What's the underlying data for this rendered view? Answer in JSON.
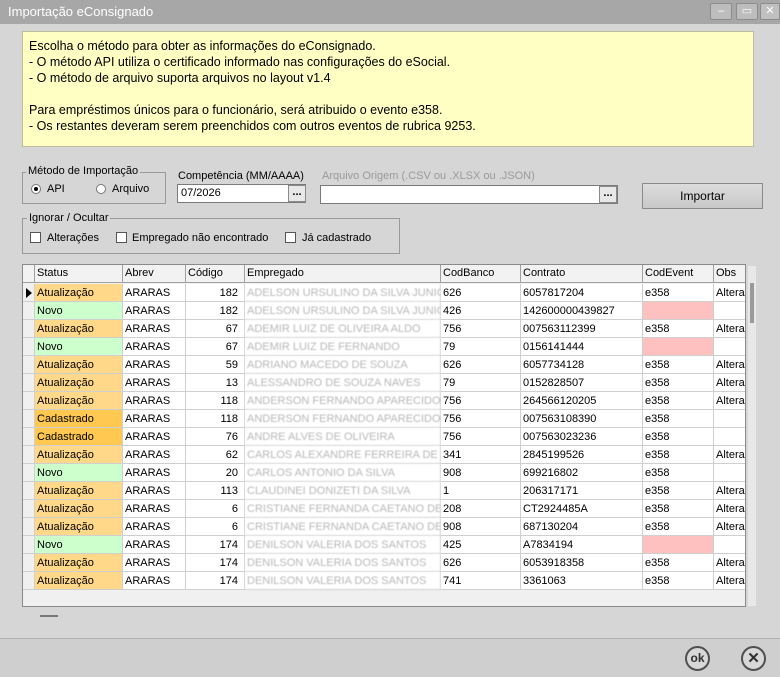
{
  "window": {
    "title": "Importação eConsignado",
    "minimize_symbol": "–",
    "maximize_symbol": "▭",
    "close_symbol": "✕"
  },
  "info_lines": [
    "Escolha o método para obter as informações do eConsignado.",
    "- O método API utiliza o certificado informado nas configurações do eSocial.",
    "- O método de arquivo suporta arquivos no layout v1.4",
    "",
    "Para empréstimos únicos para o funcionário, será atribuido o evento e358.",
    "- Os restantes deveram serem preenchidos com outros eventos de rubrica 9253."
  ],
  "method": {
    "label": "Método de Importação",
    "options": [
      {
        "label": "API",
        "selected": true
      },
      {
        "label": "Arquivo",
        "selected": false
      }
    ]
  },
  "competencia": {
    "label": "Competência (MM/AAAA)",
    "value": "07/2026",
    "button": "..."
  },
  "arquivo": {
    "label": "Arquivo Origem (.CSV ou .XLSX ou .JSON)",
    "value": "",
    "button": "..."
  },
  "import_button": "Importar",
  "ignore": {
    "label": "Ignorar / Ocultar",
    "options": [
      {
        "label": "Alterações",
        "checked": false
      },
      {
        "label": "Empregado não encontrado",
        "checked": false
      },
      {
        "label": "Já cadastrado",
        "checked": false
      }
    ]
  },
  "grid": {
    "columns": [
      "Status",
      "Abrev",
      "Código",
      "Empregado",
      "CodBanco",
      "Contrato",
      "CodEvent",
      "Obs"
    ],
    "rows": [
      {
        "status": "Atualização",
        "abrev": "ARARAS",
        "codigo": "182",
        "empregado": "ADELSON URSULINO DA SILVA JUNIOR",
        "codbanco": "626",
        "contrato": "6057817204",
        "codevent": "e358",
        "obs": "Altera"
      },
      {
        "status": "Novo",
        "abrev": "ARARAS",
        "codigo": "182",
        "empregado": "ADELSON URSULINO DA SILVA JUNIOR",
        "codbanco": "426",
        "contrato": "142600000439827",
        "codevent": "",
        "obs": ""
      },
      {
        "status": "Atualização",
        "abrev": "ARARAS",
        "codigo": "67",
        "empregado": "ADEMIR LUIZ DE OLIVEIRA ALDO",
        "codbanco": "756",
        "contrato": "007563112399",
        "codevent": "e358",
        "obs": "Altera"
      },
      {
        "status": "Novo",
        "abrev": "ARARAS",
        "codigo": "67",
        "empregado": "ADEMIR LUIZ DE FERNANDO",
        "codbanco": "79",
        "contrato": "0156141444",
        "codevent": "",
        "obs": ""
      },
      {
        "status": "Atualização",
        "abrev": "ARARAS",
        "codigo": "59",
        "empregado": "ADRIANO MACEDO DE SOUZA",
        "codbanco": "626",
        "contrato": "6057734128",
        "codevent": "e358",
        "obs": "Altera"
      },
      {
        "status": "Atualização",
        "abrev": "ARARAS",
        "codigo": "13",
        "empregado": "ALESSANDRO DE SOUZA NAVES",
        "codbanco": "79",
        "contrato": "0152828507",
        "codevent": "e358",
        "obs": "Altera"
      },
      {
        "status": "Atualização",
        "abrev": "ARARAS",
        "codigo": "118",
        "empregado": "ANDERSON FERNANDO APARECIDO GE",
        "codbanco": "756",
        "contrato": "264566120205",
        "codevent": "e358",
        "obs": "Altera"
      },
      {
        "status": "Cadastrado",
        "abrev": "ARARAS",
        "codigo": "118",
        "empregado": "ANDERSON FERNANDO APARECIDO GE",
        "codbanco": "756",
        "contrato": "007563108390",
        "codevent": "e358",
        "obs": ""
      },
      {
        "status": "Cadastrado",
        "abrev": "ARARAS",
        "codigo": "76",
        "empregado": "ANDRE ALVES DE OLIVEIRA",
        "codbanco": "756",
        "contrato": "007563023236",
        "codevent": "e358",
        "obs": ""
      },
      {
        "status": "Atualização",
        "abrev": "ARARAS",
        "codigo": "62",
        "empregado": "CARLOS ALEXANDRE FERREIRA DE BATI",
        "codbanco": "341",
        "contrato": "2845199526",
        "codevent": "e358",
        "obs": "Altera"
      },
      {
        "status": "Novo",
        "abrev": "ARARAS",
        "codigo": "20",
        "empregado": "CARLOS ANTONIO DA SILVA",
        "codbanco": "908",
        "contrato": "699216802",
        "codevent": "e358",
        "obs": ""
      },
      {
        "status": "Atualização",
        "abrev": "ARARAS",
        "codigo": "113",
        "empregado": "CLAUDINEI DONIZETI DA SILVA",
        "codbanco": "1",
        "contrato": "206317171",
        "codevent": "e358",
        "obs": "Altera"
      },
      {
        "status": "Atualização",
        "abrev": "ARARAS",
        "codigo": "6",
        "empregado": "CRISTIANE FERNANDA CAETANO DE FR",
        "codbanco": "208",
        "contrato": "CT2924485A",
        "codevent": "e358",
        "obs": "Altera"
      },
      {
        "status": "Atualização",
        "abrev": "ARARAS",
        "codigo": "6",
        "empregado": "CRISTIANE FERNANDA CAETANO DE FR",
        "codbanco": "908",
        "contrato": "687130204",
        "codevent": "e358",
        "obs": "Altera"
      },
      {
        "status": "Novo",
        "abrev": "ARARAS",
        "codigo": "174",
        "empregado": "DENILSON VALERIA DOS SANTOS",
        "codbanco": "425",
        "contrato": "A7834194",
        "codevent": "",
        "obs": ""
      },
      {
        "status": "Atualização",
        "abrev": "ARARAS",
        "codigo": "174",
        "empregado": "DENILSON VALERIA DOS SANTOS",
        "codbanco": "626",
        "contrato": "6053918358",
        "codevent": "e358",
        "obs": "Altera"
      },
      {
        "status": "Atualização",
        "abrev": "ARARAS",
        "codigo": "174",
        "empregado": "DENILSON VALERIA DOS SANTOS",
        "codbanco": "741",
        "contrato": "3361063",
        "codevent": "e358",
        "obs": "Altera"
      }
    ]
  },
  "footer": {
    "ok_label": "ok",
    "cancel_label": "✕"
  },
  "colors": {
    "status_atualizacao": "#ffd88a",
    "status_novo": "#ccffcc",
    "status_cadastrado": "#ffc850",
    "codevent_missing": "#ffc0c0",
    "info_background": "#ffffc4"
  }
}
